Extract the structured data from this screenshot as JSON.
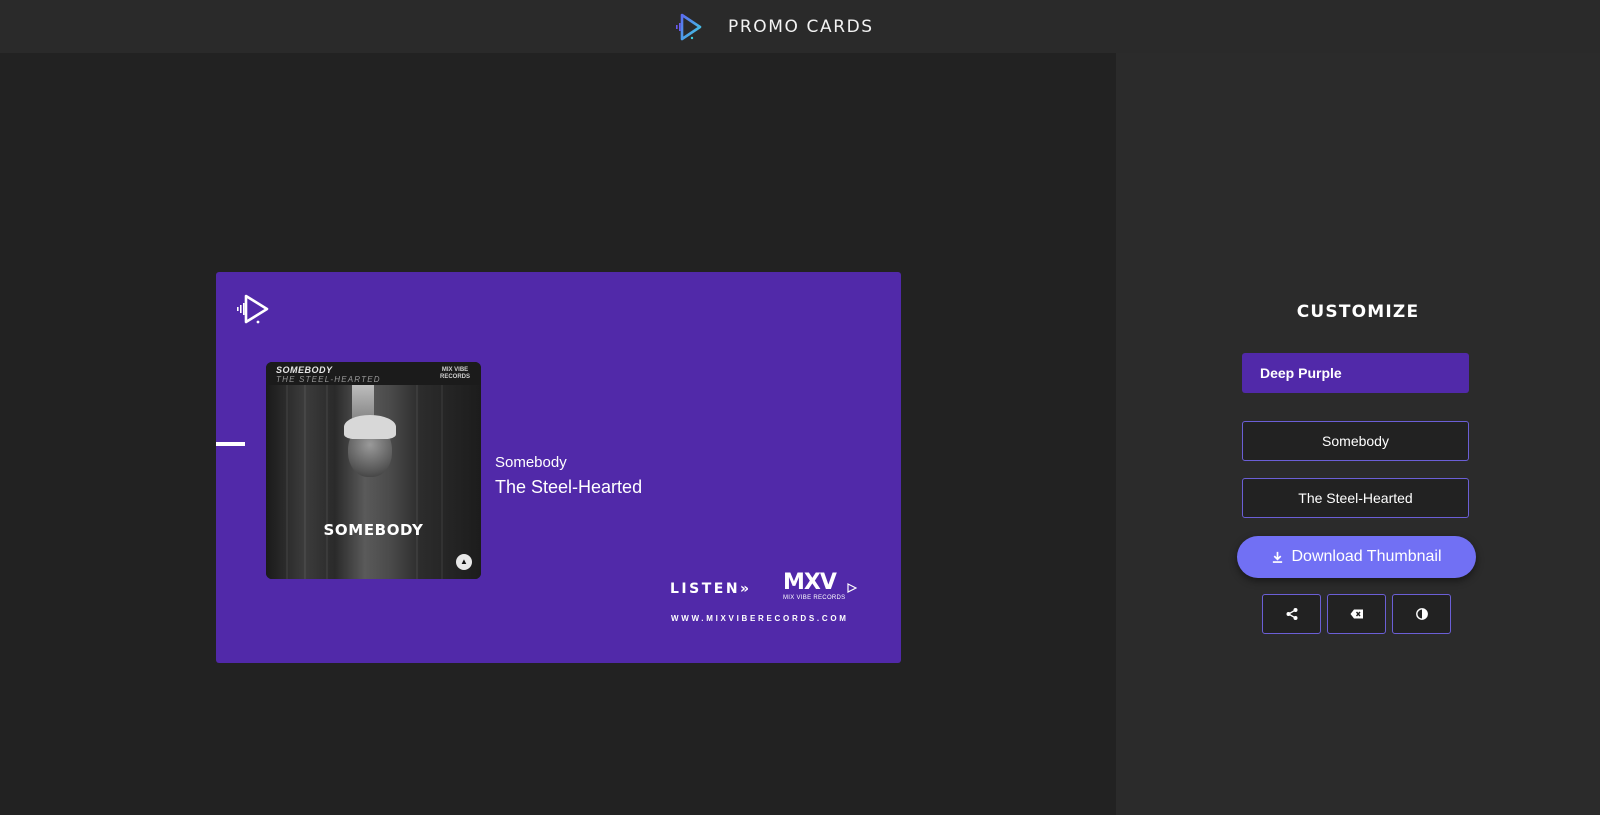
{
  "app": {
    "title": "PROMO CARDS",
    "logo_icon": "play-waveform-icon"
  },
  "card": {
    "background_color": "#5129a9",
    "logo_icon": "play-waveform-icon",
    "cover": {
      "song": "SOMEBODY",
      "artist": "THE STEEL-HEARTED",
      "label": "MIX VIBE RECORDS",
      "big_title": "SOMEBODY"
    },
    "song": "Somebody",
    "artist": "The Steel-Hearted",
    "listen_label": "LISTEN",
    "listen_arrows": "»",
    "brand_mark": "MXV",
    "brand_sub": "MIX VIBE RECORDS",
    "url": "WWW.MIXVIBERECORDS.COM"
  },
  "panel": {
    "title": "CUSTOMIZE",
    "theme": {
      "label": "Deep Purple",
      "color": "#5129a9"
    },
    "song_field": {
      "value": "Somebody"
    },
    "artist_field": {
      "value": "The Steel-Hearted"
    },
    "download_label": "Download Thumbnail",
    "download_icon": "download-icon",
    "actions": [
      {
        "name": "share",
        "icon": "share-icon"
      },
      {
        "name": "clear",
        "icon": "backspace-icon"
      },
      {
        "name": "contrast",
        "icon": "contrast-icon"
      }
    ],
    "accent_color": "#7170f4"
  }
}
